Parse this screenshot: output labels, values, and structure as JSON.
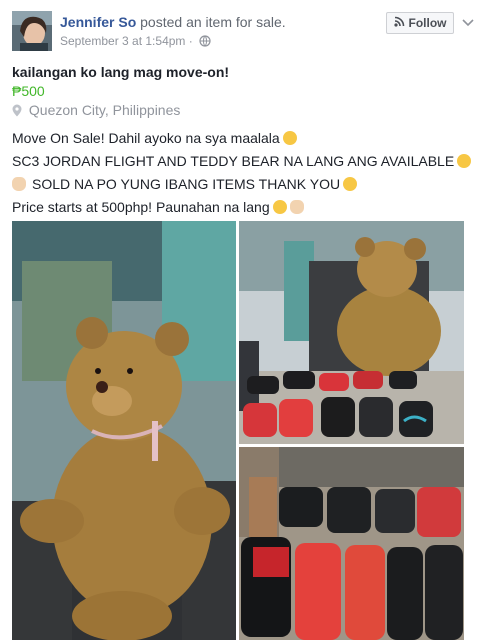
{
  "post": {
    "author": "Jennifer So",
    "action": "posted an item for sale.",
    "timestamp": "September 3 at 1:54pm",
    "separator": "·",
    "follow_label": "Follow",
    "title": "kailangan ko lang mag move-on!",
    "price": "₱500",
    "location": "Quezon City, Philippines",
    "lines": [
      "Move On Sale! Dahil ayoko na sya maalala",
      "SC3 JORDAN FLIGHT AND TEDDY BEAR NA LANG ANG AVAILABLE",
      "SOLD NA PO YUNG IBANG ITEMS THANK YOU",
      "Price starts at 500php! Paunahan na lang"
    ]
  },
  "icons": {
    "globe": "globe-icon",
    "follow": "rss-icon",
    "menu": "chevron-down-icon",
    "location": "map-pin-icon"
  },
  "colors": {
    "author": "#365899",
    "price": "#42b72a",
    "meta": "#90949c"
  }
}
